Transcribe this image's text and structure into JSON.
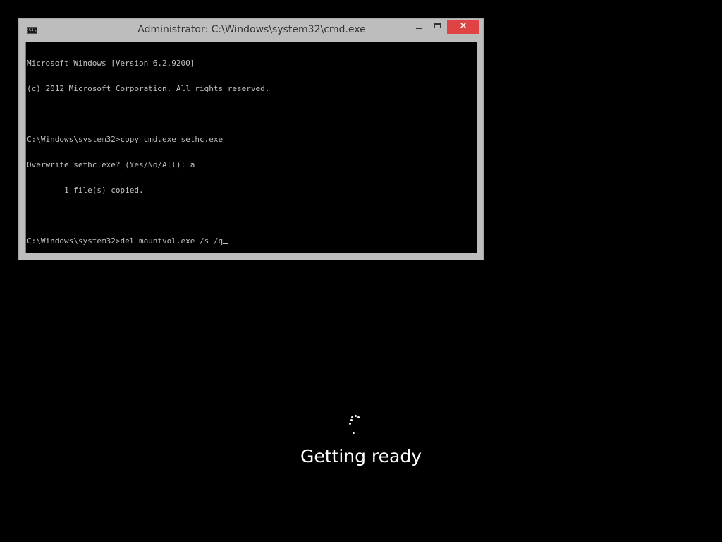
{
  "window": {
    "title": "Administrator: C:\\Windows\\system32\\cmd.exe",
    "icon": "console-app-icon",
    "icon_glyph": "C:\\",
    "controls": {
      "minimize_icon": "minimize-icon",
      "maximize_icon": "maximize-icon",
      "close_icon": "close-icon",
      "close_glyph": "✕",
      "close_color": "#e04343"
    }
  },
  "console": {
    "lines": [
      "Microsoft Windows [Version 6.2.9200]",
      "(c) 2012 Microsoft Corporation. All rights reserved.",
      "",
      "C:\\Windows\\system32>copy cmd.exe sethc.exe",
      "Overwrite sethc.exe? (Yes/No/All): a",
      "        1 file(s) copied.",
      "",
      "C:\\Windows\\system32>del mountvol.exe /s /q"
    ],
    "text_color": "#c0c0c0",
    "background_color": "#000000"
  },
  "boot_status": {
    "text": "Getting ready",
    "spinner_icon": "loading-spinner-icon"
  }
}
